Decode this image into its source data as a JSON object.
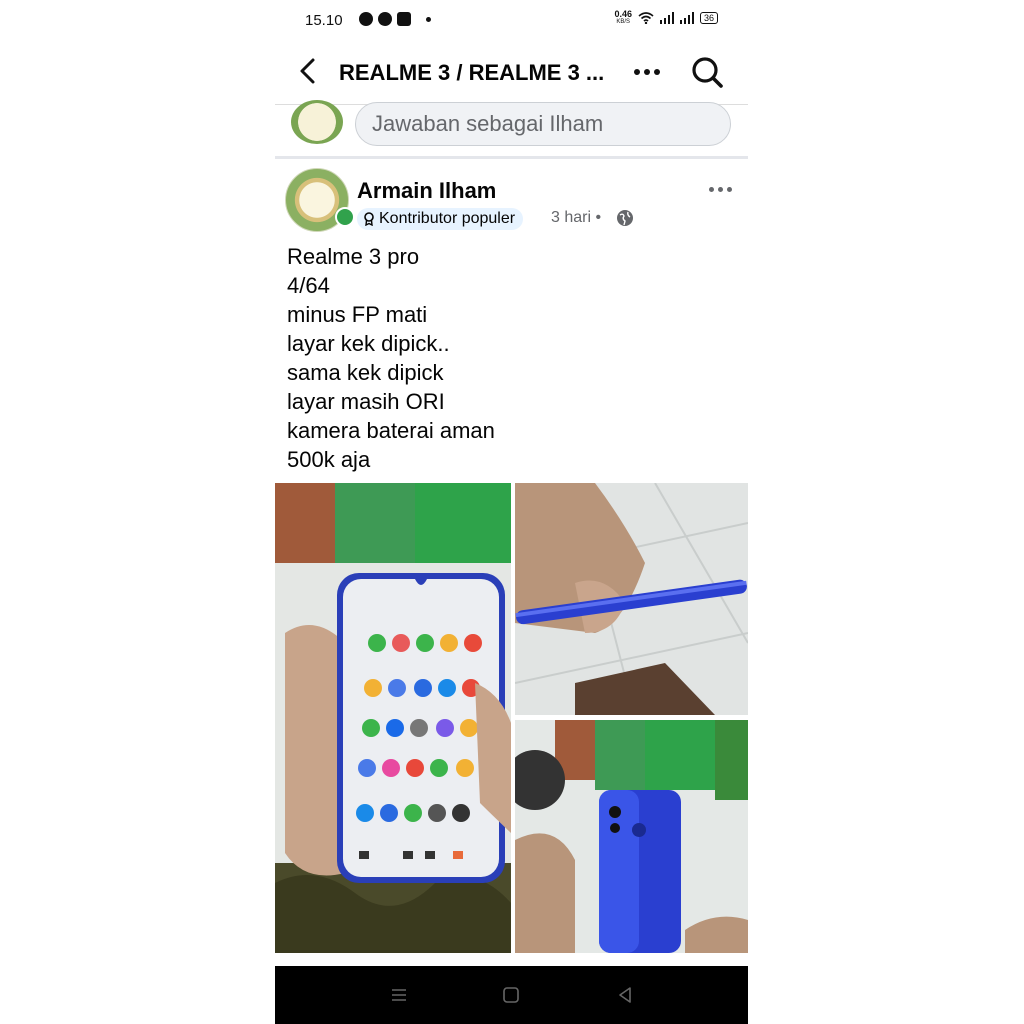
{
  "status_bar": {
    "time": "15.10",
    "net_speed": "0.46",
    "net_unit": "KB/S",
    "battery": "36"
  },
  "header": {
    "title": "REALME 3 / REALME 3 ..."
  },
  "reply": {
    "placeholder": "Jawaban sebagai Ilham"
  },
  "post": {
    "author": "Armain Ilham",
    "badge": "Kontributor populer",
    "time": "3 hari",
    "separator": "•",
    "lines": [
      "Realme 3 pro",
      "4/64",
      "minus FP mati",
      "layar kek dipick..",
      "sama kek dipick",
      "layar masih ORI",
      "kamera baterai aman",
      "500k aja"
    ]
  },
  "colors": {
    "online": "#31a24c",
    "badge_bg": "#e7f3ff",
    "secondary_text": "#65676b",
    "phone_blue": "#2a3fd0"
  },
  "icons": {
    "back": "chevron-left-icon",
    "more": "more-horizontal-icon",
    "search": "search-icon",
    "globe": "globe-icon",
    "badge": "award-icon"
  }
}
